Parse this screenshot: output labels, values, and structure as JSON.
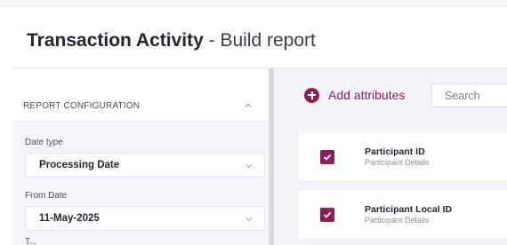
{
  "header": {
    "title_bold": "Transaction Activity",
    "title_rest": " - Build report"
  },
  "config": {
    "section_label": "REPORT CONFIGURATION",
    "date_type": {
      "label": "Date type",
      "value": "Processing Date"
    },
    "from_date": {
      "label": "From Date",
      "value": "11-May-2025"
    },
    "next_label_partial": "T..."
  },
  "attributes": {
    "add_label": "Add attributes",
    "search_placeholder": "Search",
    "items": [
      {
        "name": "Participant ID",
        "group": "Participant Details",
        "checked": true
      },
      {
        "name": "Participant Local ID",
        "group": "Participant Details",
        "checked": true
      }
    ]
  },
  "colors": {
    "accent": "#8d1f58",
    "panel_bg": "#f6f6fa",
    "splitter": "#d9dae4"
  }
}
